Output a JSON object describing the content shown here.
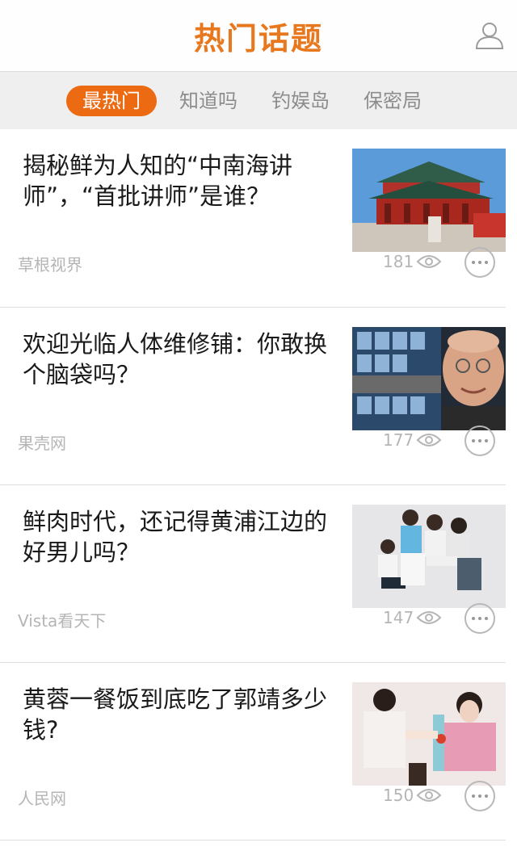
{
  "header": {
    "title": "热门话题",
    "user_icon": "user-icon"
  },
  "tabs": [
    {
      "label": "最热门",
      "active": true
    },
    {
      "label": "知道吗",
      "active": false
    },
    {
      "label": "钓娱岛",
      "active": false
    },
    {
      "label": "保密局",
      "active": false
    }
  ],
  "feed": [
    {
      "title": "揭秘鲜为人知的“中南海讲师”，“首批讲师”是谁？",
      "source": "草根视界",
      "views": "181"
    },
    {
      "title": "欢迎光临人体维修铺：你敢换个脑袋吗？",
      "source": "果壳网",
      "views": "177"
    },
    {
      "title": "鲜肉时代，还记得黄浦江边的好男儿吗？",
      "source": "Vista看天下",
      "views": "147"
    },
    {
      "title": "黄蓉一餐饭到底吃了郭靖多少钱?",
      "source": "人民网",
      "views": "150"
    }
  ],
  "colors": {
    "accent": "#e8781e",
    "tab_active_bg": "#ec6b12",
    "muted": "#b5b5b5"
  },
  "icons": {
    "eye": "eye-icon",
    "more": "more-icon"
  }
}
